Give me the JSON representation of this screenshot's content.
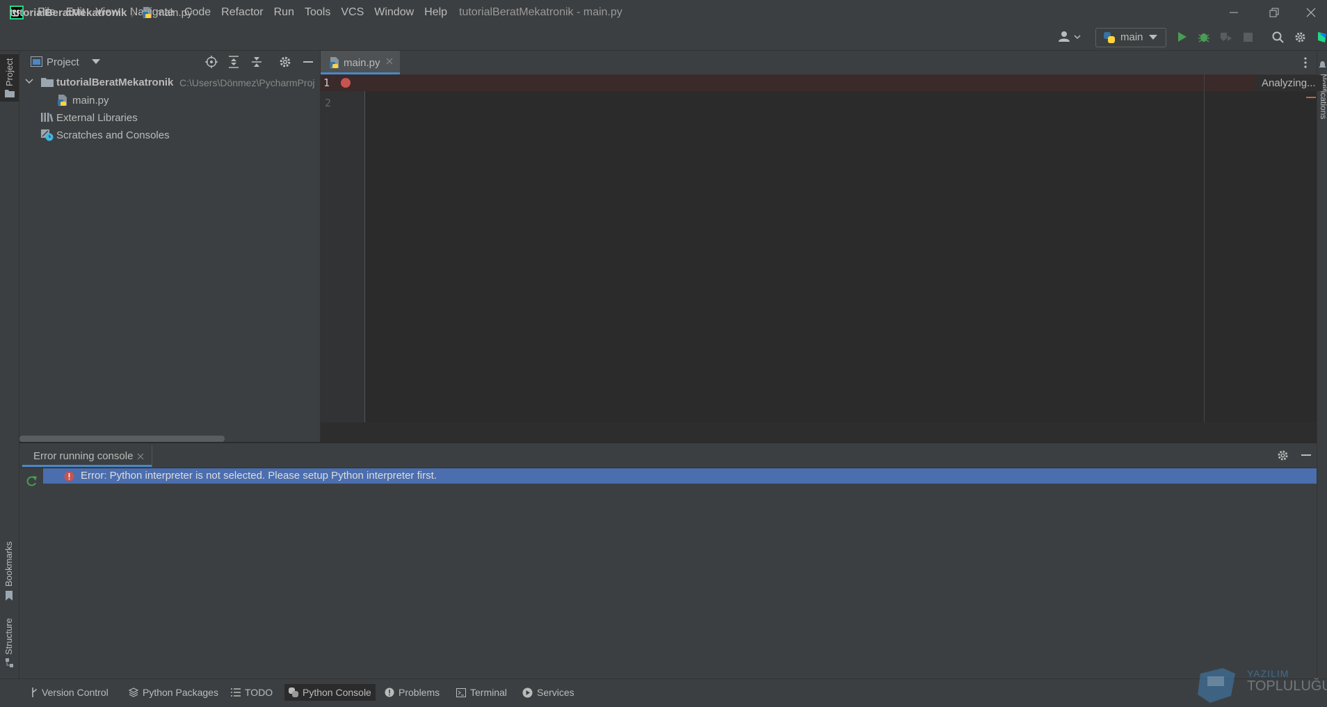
{
  "window": {
    "title": "tutorialBeratMekatronik - main.py",
    "menu": [
      "File",
      "Edit",
      "View",
      "Navigate",
      "Code",
      "Refactor",
      "Run",
      "Tools",
      "VCS",
      "Window",
      "Help"
    ]
  },
  "navbar": {
    "project": "tutorialBeratMekatronik",
    "file": "main.py",
    "run_config": "main"
  },
  "left_strip": {
    "project": "Project",
    "bookmarks": "Bookmarks",
    "structure": "Structure"
  },
  "right_strip": {
    "notifications": "Notifications"
  },
  "project_panel": {
    "title": "Project",
    "tree": {
      "root_name": "tutorialBeratMekatronik",
      "root_path": "C:\\Users\\Dönmez\\PycharmProj",
      "file": "main.py",
      "external": "External Libraries",
      "scratches": "Scratches and Consoles"
    }
  },
  "editor": {
    "tab": "main.py",
    "lines": [
      "1",
      "2"
    ],
    "status": "Analyzing..."
  },
  "console": {
    "tab": "Error running console",
    "error": "Error: Python interpreter is not selected. Please setup Python interpreter first."
  },
  "tool_buttons": [
    "Version Control",
    "Python Packages",
    "TODO",
    "Python Console",
    "Problems",
    "Terminal",
    "Services"
  ],
  "watermark": {
    "line1": "YAZILIM",
    "line2": "TOPLULUĞU"
  },
  "colors": {
    "accent": "#4a88c7",
    "selection": "#4b6eaf",
    "error": "#c75450",
    "run": "#499c54",
    "bg_panel": "#3c3f41",
    "bg_editor": "#2b2b2b"
  }
}
